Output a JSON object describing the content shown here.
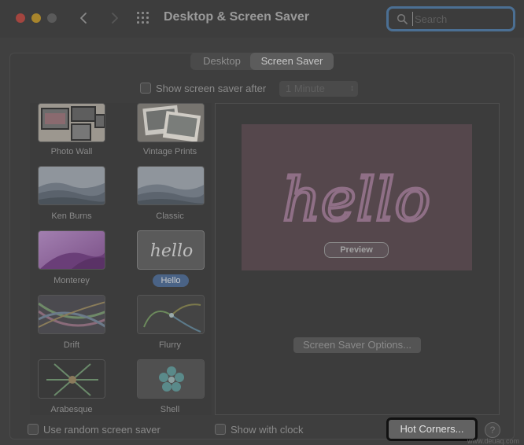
{
  "window": {
    "title": "Desktop & Screen Saver"
  },
  "search": {
    "placeholder": "Search"
  },
  "tabs": [
    {
      "label": "Desktop",
      "selected": false
    },
    {
      "label": "Screen Saver",
      "selected": true
    }
  ],
  "show_after": {
    "label": "Show screen saver after",
    "checked": false,
    "value": "1 Minute"
  },
  "savers": [
    {
      "label": "Photo Wall"
    },
    {
      "label": "Vintage Prints"
    },
    {
      "label": "Ken Burns"
    },
    {
      "label": "Classic"
    },
    {
      "label": "Monterey"
    },
    {
      "label": "Hello",
      "selected": true
    },
    {
      "label": "Drift"
    },
    {
      "label": "Flurry"
    },
    {
      "label": "Arabesque"
    },
    {
      "label": "Shell"
    }
  ],
  "preview": {
    "text": "hello",
    "button_label": "Preview"
  },
  "options_button": "Screen Saver Options...",
  "random": {
    "label": "Use random screen saver",
    "checked": false
  },
  "clock": {
    "label": "Show with clock",
    "checked": false
  },
  "hot_corners_button": "Hot Corners...",
  "help": "?",
  "watermark": "www.deuaq.com",
  "colors": {
    "selection": "#4a6386",
    "focus_ring": "#4b6f93"
  }
}
